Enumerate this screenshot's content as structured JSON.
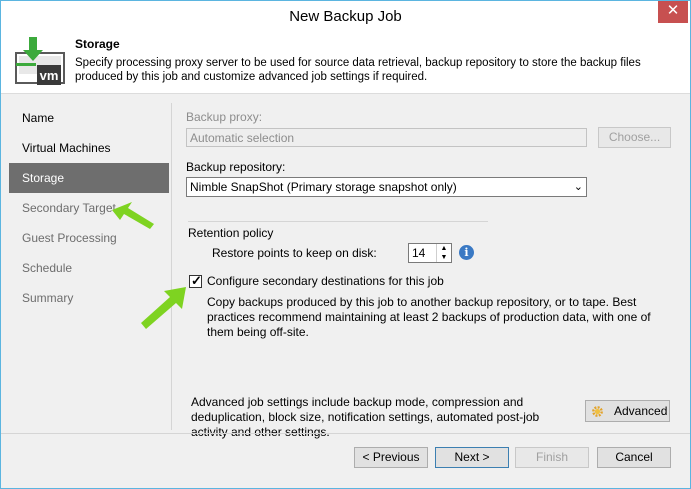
{
  "window": {
    "title": "New Backup Job",
    "close_symbol": "✕"
  },
  "header": {
    "title": "Storage",
    "description": "Specify processing proxy server to be used for source data retrieval, backup repository to store the backup files produced by this job and customize advanced job settings if required.",
    "logo_text": "vm"
  },
  "nav": {
    "items": [
      {
        "label": "Name",
        "state": "normal"
      },
      {
        "label": "Virtual Machines",
        "state": "normal"
      },
      {
        "label": "Storage",
        "state": "active"
      },
      {
        "label": "Secondary Target",
        "state": "disabled"
      },
      {
        "label": "Guest Processing",
        "state": "disabled"
      },
      {
        "label": "Schedule",
        "state": "disabled"
      },
      {
        "label": "Summary",
        "state": "disabled"
      }
    ]
  },
  "storage": {
    "proxy_label": "Backup proxy:",
    "proxy_value": "Automatic selection",
    "choose_label": "Choose...",
    "repository_label": "Backup repository:",
    "repository_value": "Nimble SnapShot (Primary storage snapshot only)",
    "retention_label": "Retention policy",
    "restore_points_label": "Restore points to keep on disk:",
    "restore_points_value": "14",
    "secondary_checkbox_label": "Configure secondary destinations for this job",
    "secondary_checked": true,
    "secondary_description": "Copy backups produced by this job to another backup repository, or to tape. Best practices recommend maintaining at least 2 backups of production data, with one of them being off-site.",
    "advanced_description": "Advanced job settings include backup mode, compression and deduplication, block size, notification settings, automated post-job activity and other settings.",
    "advanced_label": "Advanced"
  },
  "footer": {
    "previous_label": "< Previous",
    "next_label": "Next >",
    "finish_label": "Finish",
    "cancel_label": "Cancel"
  },
  "colors": {
    "accent": "#5bb5e0",
    "close": "#c75050",
    "active_nav": "#6e6e6e",
    "annotation_arrow": "#7ed321",
    "info": "#3a79c4"
  }
}
